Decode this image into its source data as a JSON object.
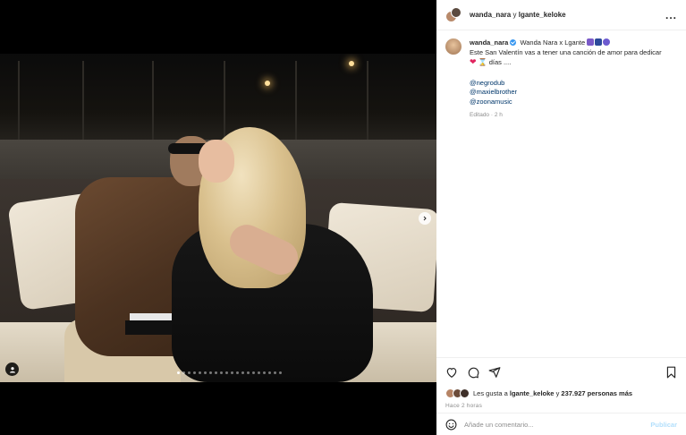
{
  "header": {
    "user1": "wanda_nara",
    "separator": "y",
    "user2": "lgante_keloke",
    "more_label": "..."
  },
  "caption": {
    "username": "wanda_nara",
    "line1_text": "Wanda Nara x Lgante",
    "line2_text": "Este San Valentín vas a tener una canción de amor para dedicar",
    "line3_text": "días ....",
    "mentions": [
      "@negrodub",
      "@maxielbrother",
      "@zoonamusic"
    ],
    "edited": "Editado · 2 h"
  },
  "likes": {
    "prefix": "Les gusta a",
    "user": "lgante_keloke",
    "joiner": "y",
    "count": "237.927 personas más"
  },
  "time_ago": "Hace 2 horas",
  "comment": {
    "placeholder": "Añade un comentario...",
    "post_label": "Publicar"
  },
  "carousel": {
    "total": 20,
    "active_index": 0
  },
  "icons": {
    "like": "heart-icon",
    "comment": "comment-icon",
    "share": "share-icon",
    "save": "bookmark-icon",
    "emoji": "emoji-icon",
    "next": "chevron-right-icon",
    "tag": "user-tag-icon"
  },
  "colors": {
    "link": "#00376b",
    "verified": "#3897f0",
    "muted": "#8e8e8e",
    "post_button": "#b2dffc"
  }
}
